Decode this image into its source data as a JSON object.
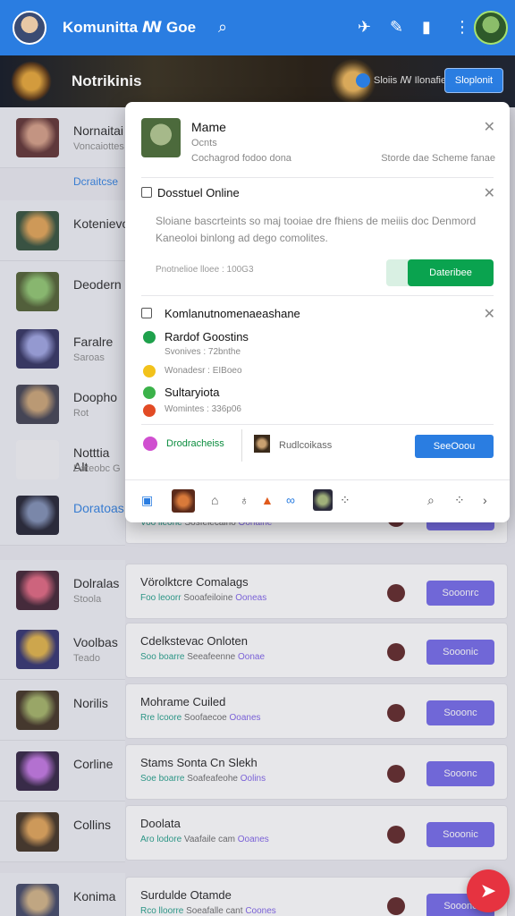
{
  "topbar": {
    "title": "Komunitta ꟿ Goe",
    "icons": [
      "search-icon",
      "pin-icon",
      "edit-icon",
      "bookmark-icon",
      "more-icon"
    ]
  },
  "banner": {
    "title": "Notrikinis",
    "status": "Sloiis ꟿ Ilonafie",
    "button": "Sloplonit"
  },
  "rows": [
    {
      "name": "Nornaitai",
      "sub": "Voncaiottes",
      "link": "Dcraitcse"
    },
    {
      "name": "Kotenievo",
      "sub": ""
    },
    {
      "name": "Deodern",
      "sub": ""
    },
    {
      "name": "Faralre",
      "sub": "Saroas"
    },
    {
      "name": "Doopho",
      "sub": "Rot"
    },
    {
      "name": "Notttia Alt",
      "sub": "Dateobc G"
    },
    {
      "name": "Doratoas",
      "sub": ""
    },
    {
      "name": "Dolralas",
      "sub": "Stoola"
    },
    {
      "name": "Voolbas",
      "sub": "Teado"
    },
    {
      "name": "Norilis",
      "sub": ""
    },
    {
      "name": "Corline",
      "sub": ""
    },
    {
      "name": "Collins",
      "sub": ""
    },
    {
      "name": "Konima",
      "sub": ""
    }
  ],
  "cards": [
    {
      "title": "",
      "meta1": "Voo lleone",
      "meta2": "Sosfelecaino",
      "meta3": "Oohaine",
      "button": ""
    },
    {
      "title": "Vörolktcre Comalags",
      "meta1": "Foo leoorr",
      "meta2": "Sooafeiloine",
      "meta3": "Ooneas",
      "button": "Sooonrc"
    },
    {
      "title": "Cdelkstevac Onloten",
      "meta1": "Soo boarre",
      "meta2": "Seeafeenne",
      "meta3": "Oonae",
      "button": "Sooonic"
    },
    {
      "title": "Mohrame Cuiled",
      "meta1": "Rre lcoore",
      "meta2": "Soofaecoe",
      "meta3": "Ooanes",
      "button": "Sooonc"
    },
    {
      "title": "Stams Sonta Cn Slekh",
      "meta1": "Soe boarre",
      "meta2": "Soafeafeohe",
      "meta3": "Oolins",
      "button": "Sooonc"
    },
    {
      "title": "Doolata",
      "meta1": "Aro lodore",
      "meta2": "Vaafaile cam",
      "meta3": "Ooanes",
      "button": "Sooonic"
    },
    {
      "title": "Surdulde Otamde",
      "meta1": "Rco lloorre",
      "meta2": "Soeafalle cant",
      "meta3": "Coones",
      "button": "Sooonc"
    }
  ],
  "popup": {
    "name": "Mame",
    "sub": "Ocnts",
    "meta_left": "Cochagrod fodoo dona",
    "meta_right": "Storde dae Scheme fanae",
    "sec1_title": "Dosstuel Online",
    "description": "Sloiane bascrteints so maj tooiae dre fhiens de meiiis doc Denmord Kaneoloi binlong ad dego comolites.",
    "small_meta": "Pnotnelioe lloee : 100G3",
    "join_button": "Dateribee",
    "sec2_title": "Komlanutnomenaeashane",
    "items": [
      {
        "title": "Rardof Goostins",
        "sub": "Svonives : 72bnthe"
      },
      {
        "title": "",
        "sub": "Wonadesr : EIBoeo"
      },
      {
        "title": "Sultaryiota",
        "sub": "Womintes : 336p06"
      }
    ],
    "footer_left": "Drodracheiss",
    "footer_mid": "Rudlcoikass",
    "footer_button": "SeeOoou"
  }
}
